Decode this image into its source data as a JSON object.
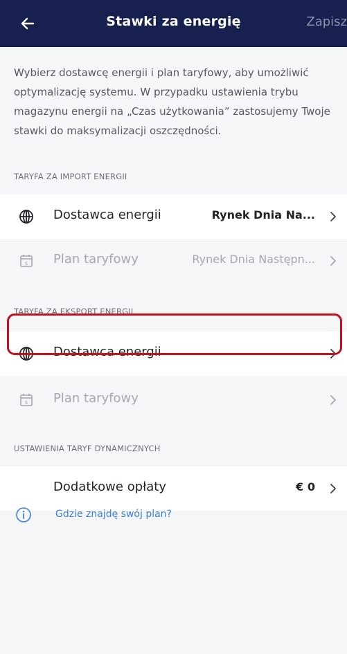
{
  "header": {
    "title": "Stawki za energię",
    "save_label": "Zapisz"
  },
  "description": "Wybierz dostawcę energii i plan taryfowy, aby umożliwić optymalizację systemu. W przypadku ustawienia trybu magazynu energii na „Czas użytkowania” zastosujemy Twoje stawki do maksymalizacji oszczędności.",
  "import_section": {
    "header": "TARYFA ZA IMPORT ENERGII",
    "provider_label": "Dostawca energii",
    "provider_value": "Rynek Dnia Na...",
    "plan_label": "Plan taryfowy",
    "plan_value": "Rynek Dnia Następn..."
  },
  "export_section": {
    "header": "TARYFA ZA EKSPORT ENERGII",
    "provider_label": "Dostawca energii",
    "plan_label": "Plan taryfowy"
  },
  "dynamic_section": {
    "header": "USTAWIENIA TARYF DYNAMICZNYCH",
    "fees_label": "Dodatkowe opłaty",
    "fees_value": "€ 0"
  },
  "help_link": "Gdzie znajdę swój plan?",
  "colors": {
    "header_bg": "#17204e",
    "highlight_border": "#c1121f",
    "link": "#3a7fd6"
  }
}
